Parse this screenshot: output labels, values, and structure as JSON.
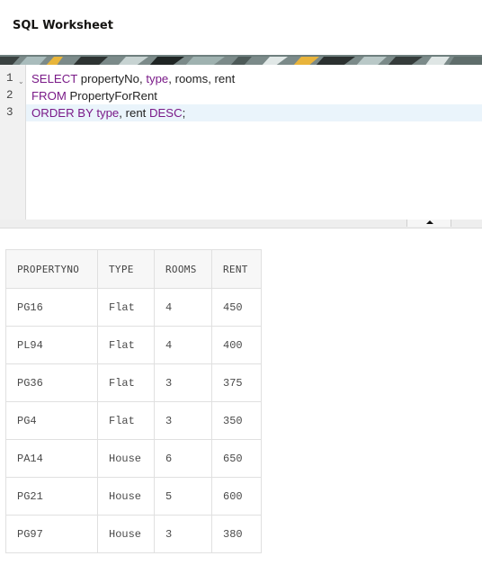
{
  "worksheet": {
    "title": "SQL Worksheet"
  },
  "editor": {
    "lines": [
      {
        "number": "1",
        "tokens": [
          {
            "t": "SELECT",
            "kw": true
          },
          {
            "t": " propertyNo, ",
            "kw": false
          },
          {
            "t": "type",
            "kw": true
          },
          {
            "t": ", rooms, rent",
            "kw": false
          }
        ]
      },
      {
        "number": "2",
        "tokens": [
          {
            "t": "FROM",
            "kw": true
          },
          {
            "t": " PropertyForRent",
            "kw": false
          }
        ]
      },
      {
        "number": "3",
        "tokens": [
          {
            "t": "ORDER BY",
            "kw": true
          },
          {
            "t": " ",
            "kw": false
          },
          {
            "t": "type",
            "kw": true
          },
          {
            "t": ", rent ",
            "kw": false
          },
          {
            "t": "DESC",
            "kw": true
          },
          {
            "t": ";",
            "kw": false
          }
        ]
      }
    ],
    "active_line": 3,
    "keyword_color": "#7a1a88"
  },
  "results": {
    "columns": [
      "PROPERTYNO",
      "TYPE",
      "ROOMS",
      "RENT"
    ],
    "rows": [
      [
        "PG16",
        "Flat",
        "4",
        "450"
      ],
      [
        "PL94",
        "Flat",
        "4",
        "400"
      ],
      [
        "PG36",
        "Flat",
        "3",
        "375"
      ],
      [
        "PG4",
        "Flat",
        "3",
        "350"
      ],
      [
        "PA14",
        "House",
        "6",
        "650"
      ],
      [
        "PG21",
        "House",
        "5",
        "600"
      ],
      [
        "PG97",
        "House",
        "3",
        "380"
      ]
    ]
  }
}
